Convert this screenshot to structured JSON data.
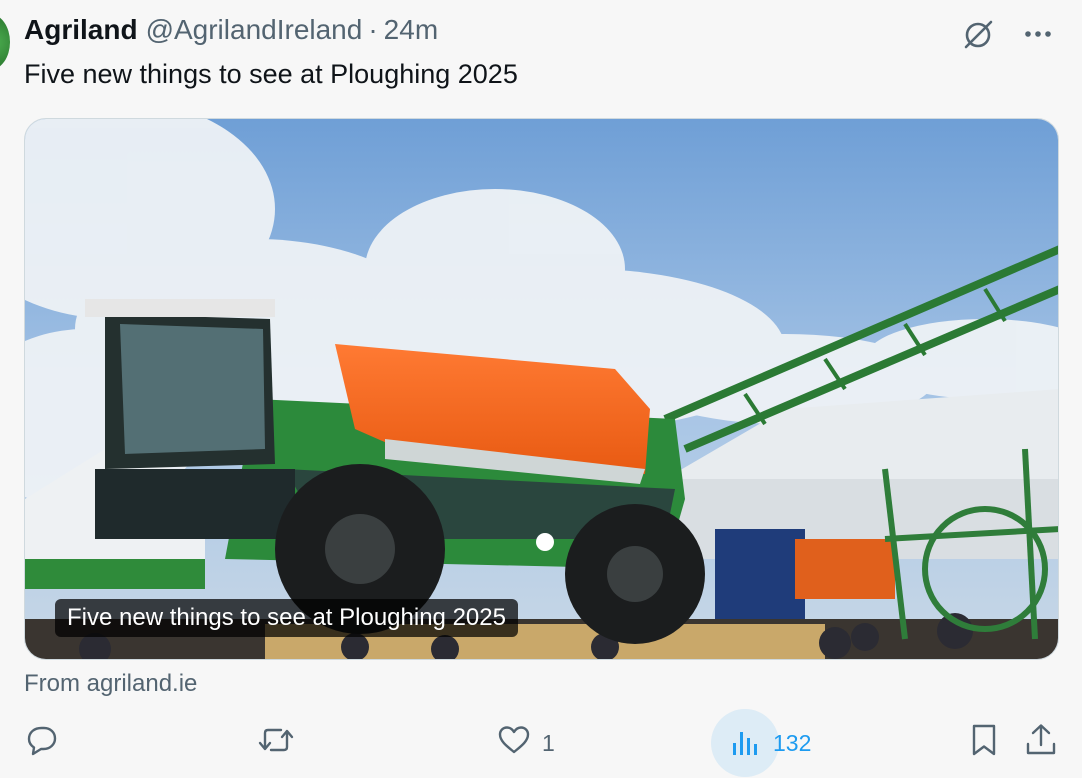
{
  "tweet": {
    "display_name": "Agriland",
    "handle": "@AgrilandIreland",
    "separator": "·",
    "time": "24m",
    "text": "Five new things to see at Ploughing 2025",
    "avatar_color": "#2e7d32"
  },
  "header_actions": {
    "grok_icon": "slashed-circle-icon",
    "more_icon": "ellipsis-icon"
  },
  "card": {
    "caption": "Five new things to see at Ploughing 2025",
    "image_description_icon": "sprayer-photo",
    "source": "From agriland.ie"
  },
  "actions": {
    "reply_count": "",
    "repost_count": "",
    "like_count": "1",
    "views_count": "132",
    "accent_color": "#1d9bf0",
    "muted_color": "#536471"
  }
}
